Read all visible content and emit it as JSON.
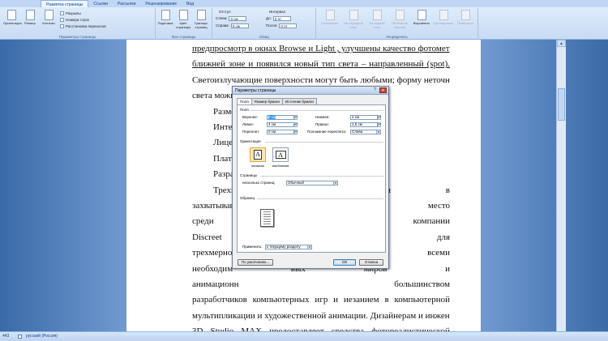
{
  "ribbon": {
    "file_tab": "",
    "tabs": [
      "Разметка страницы",
      "Ссылки",
      "Рассылки",
      "Рецензирование",
      "Вид"
    ],
    "groups": {
      "page_setup": {
        "label": "Параметры страницы",
        "orientation": "Ориентация",
        "size": "Размер",
        "columns": "Колонки",
        "breaks": "Разрывы",
        "line_numbers": "Номера строк",
        "hyphenation": "Расстановка переносов"
      },
      "page_background": {
        "label": "Фон страницы",
        "watermark": "Подложка",
        "page_color": "Цвет страницы",
        "page_borders": "Границы страниц"
      },
      "paragraph": {
        "label": "Абзац",
        "indent_title": "Отступ",
        "indent_left_label": "Слева:",
        "indent_left_value": "0 см",
        "indent_right_label": "Справа:",
        "indent_right_value": "0 см",
        "spacing_title": "Интервал",
        "spacing_before_label": "До:",
        "spacing_before_value": "0 пт",
        "spacing_after_label": "После:",
        "spacing_after_value": "0 пт"
      },
      "arrange": {
        "label": "Упорядочить",
        "position": "Положение",
        "bring_front": "На передний план",
        "send_back": "На задний план",
        "text_wrap": "Обтекание текстом",
        "align": "Выровнять",
        "group": "Группировать",
        "rotate": "Повернуть"
      }
    }
  },
  "document": {
    "lines": [
      "предпросмотр в окнах Browse и Light , улучшены качество фотометрии в",
      "ближней зоне и появился новый тип света – направленный (spot).",
      "Светоизлучающие поверхности могут быть любыми; форму неточника",
      "света можи",
      "Разме",
      "Интер",
      "Лицен",
      "Плато",
      "Разра",
      "Трехм                                                              ющие двери в",
      "захватываю                                                        ют особое место",
      "среди  ком                                                      MAX  компании",
      "Discreet   я                                                     риложений   для",
      "трехмерно                                                       н обладает всеми",
      "необходим                                                       вых   миров   и",
      "анимационн                                                           большинством",
      "разработчиков  компьютерных  игр  и  иезанием  в  компьютерной",
      "мультипликации и художественной анимации. Дизайнерам и инженерам",
      "3D   Studio   MAX   предоставляет   средства   фотореалистической",
      "визуализации  для  анализа  разрабатываемого  проекта,  проведения"
    ]
  },
  "dialog": {
    "title": "Параметры страницы",
    "help": "?",
    "close": "✕",
    "tabs": [
      "Поля",
      "Размер бумаги",
      "Источник бумаги"
    ],
    "margins_section": "Поля",
    "top_label": "Верхнее:",
    "top_value": "2 см",
    "bottom_label": "Нижнее:",
    "bottom_value": "2 см",
    "left_label": "Левое:",
    "left_value": "4 см",
    "right_label": "Правое:",
    "right_value": "1,5 см",
    "gutter_label": "Переплет:",
    "gutter_value": "0 см",
    "gutter_pos_label": "Положение переплета:",
    "gutter_pos_value": "Слева",
    "orientation_section": "Ориентация",
    "portrait_label": "книжная",
    "landscape_label": "альбомная",
    "pages_section": "Страницы",
    "multiple_pages_label": "несколько страниц:",
    "multiple_pages_value": "Обычный",
    "preview_section": "Образец",
    "apply_label": "Применить:",
    "apply_value": "к текущему разделу",
    "default_button": "По умолчанию...",
    "ok_button": "ОК",
    "cancel_button": "Отмена"
  },
  "statusbar": {
    "words": "443",
    "language": "русский (Россия)"
  }
}
